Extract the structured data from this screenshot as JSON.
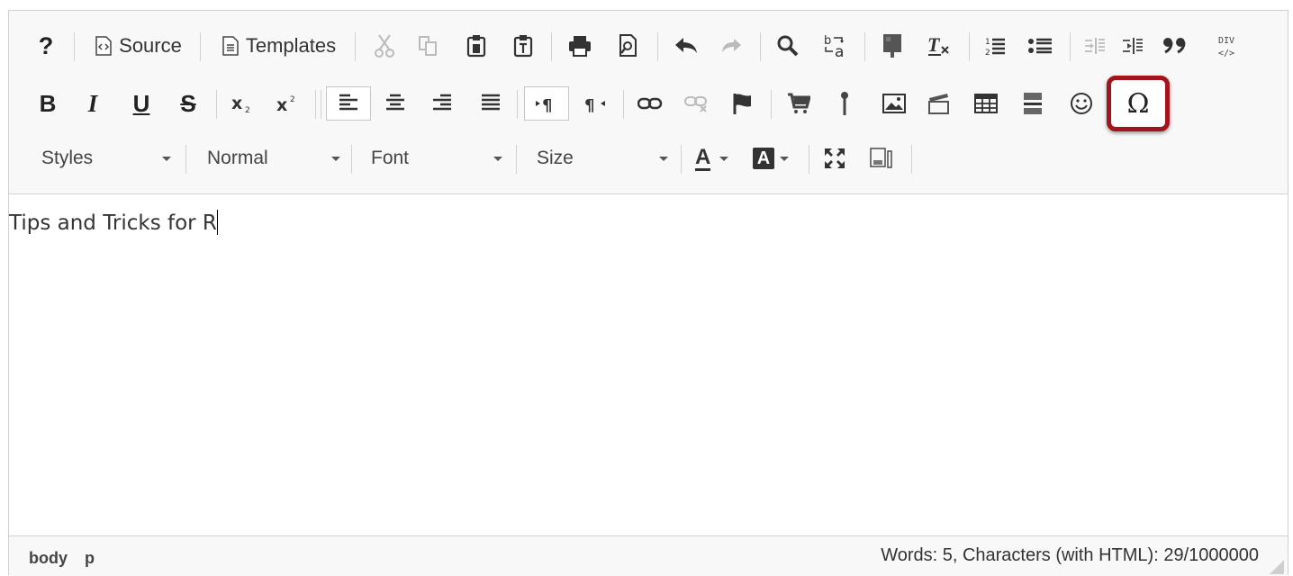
{
  "toolbar": {
    "row1": {
      "help": "?",
      "source_label": "Source",
      "templates_label": "Templates"
    },
    "row2": {
      "bold": "B",
      "italic": "I",
      "underline": "U",
      "strike": "S",
      "special_char": "Ω"
    },
    "row3": {
      "styles": "Styles",
      "format": "Normal",
      "font": "Font",
      "size": "Size",
      "text_color": "A",
      "bg_color": "A"
    }
  },
  "content": {
    "text": "Tips and Tricks for R"
  },
  "statusbar": {
    "path": [
      "body",
      "p"
    ],
    "count": "Words: 5, Characters (with HTML): 29/1000000"
  },
  "colors": {
    "highlight": "#a4141c",
    "toolbar_bg": "#f8f8f8",
    "border": "#d1d1d1"
  }
}
